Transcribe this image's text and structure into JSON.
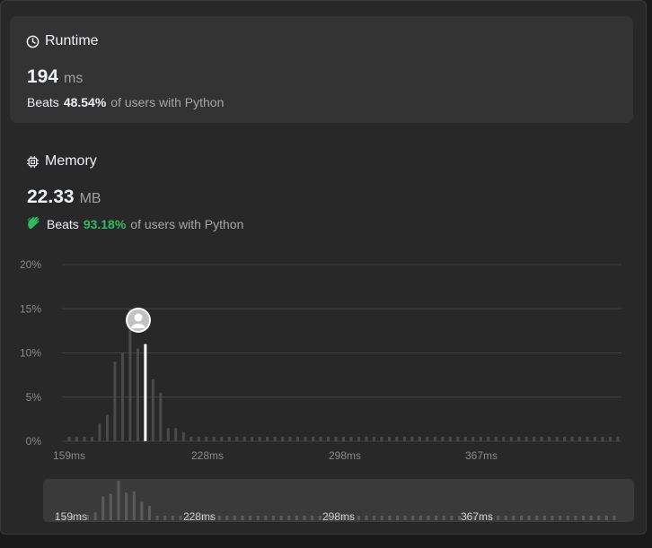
{
  "runtime": {
    "title": "Runtime",
    "icon": "clock-icon",
    "value": "194",
    "unit": "ms",
    "beats_label": "Beats",
    "beats_pct": "48.54%",
    "beats_suffix": "of users with Python"
  },
  "memory": {
    "title": "Memory",
    "icon": "chip-icon",
    "value": "22.33",
    "unit": "MB",
    "beats_label": "Beats",
    "beats_pct": "93.18%",
    "beats_suffix": "of users with Python",
    "beats_icon": "clapping-hands-icon"
  },
  "colors": {
    "accent_green": "#2cbb5d",
    "bar": "#4a4a4a",
    "bar_highlight": "#ffffff",
    "panel": "#282828",
    "card": "#333333"
  },
  "chart_data": {
    "type": "bar",
    "ylim": [
      0,
      20
    ],
    "yticks": [
      "0%",
      "5%",
      "10%",
      "15%",
      "20%"
    ],
    "xticks": [
      "159ms",
      "228ms",
      "298ms",
      "367ms"
    ],
    "values": [
      0.5,
      0.5,
      0.5,
      0.5,
      2,
      3,
      9,
      10,
      15,
      10.5,
      11,
      7,
      5.5,
      1.5,
      1.5,
      1,
      0.5,
      0.5,
      0.5,
      0.5,
      0.5,
      0.5,
      0.5,
      0.5,
      0.5,
      0.5,
      0.5,
      0.5,
      0.5,
      0.5,
      0.5,
      0.5,
      0.5,
      0.5,
      0.5,
      0.5,
      0.5,
      0.5,
      0.5,
      0.5,
      0.5,
      0.5,
      0.5,
      0.5,
      0.5,
      0.5,
      0.5,
      0.5,
      0.5,
      0.5,
      0.5,
      0.5,
      0.5,
      0.5,
      0.5,
      0.5,
      0.5,
      0.5,
      0.5,
      0.5,
      0.5,
      0.5,
      0.5,
      0.5,
      0.5,
      0.5,
      0.5,
      0.5,
      0.5,
      0.5,
      0.5,
      0.5,
      0.5
    ],
    "highlight_index": 10,
    "marker": "user-avatar",
    "grid": true
  }
}
